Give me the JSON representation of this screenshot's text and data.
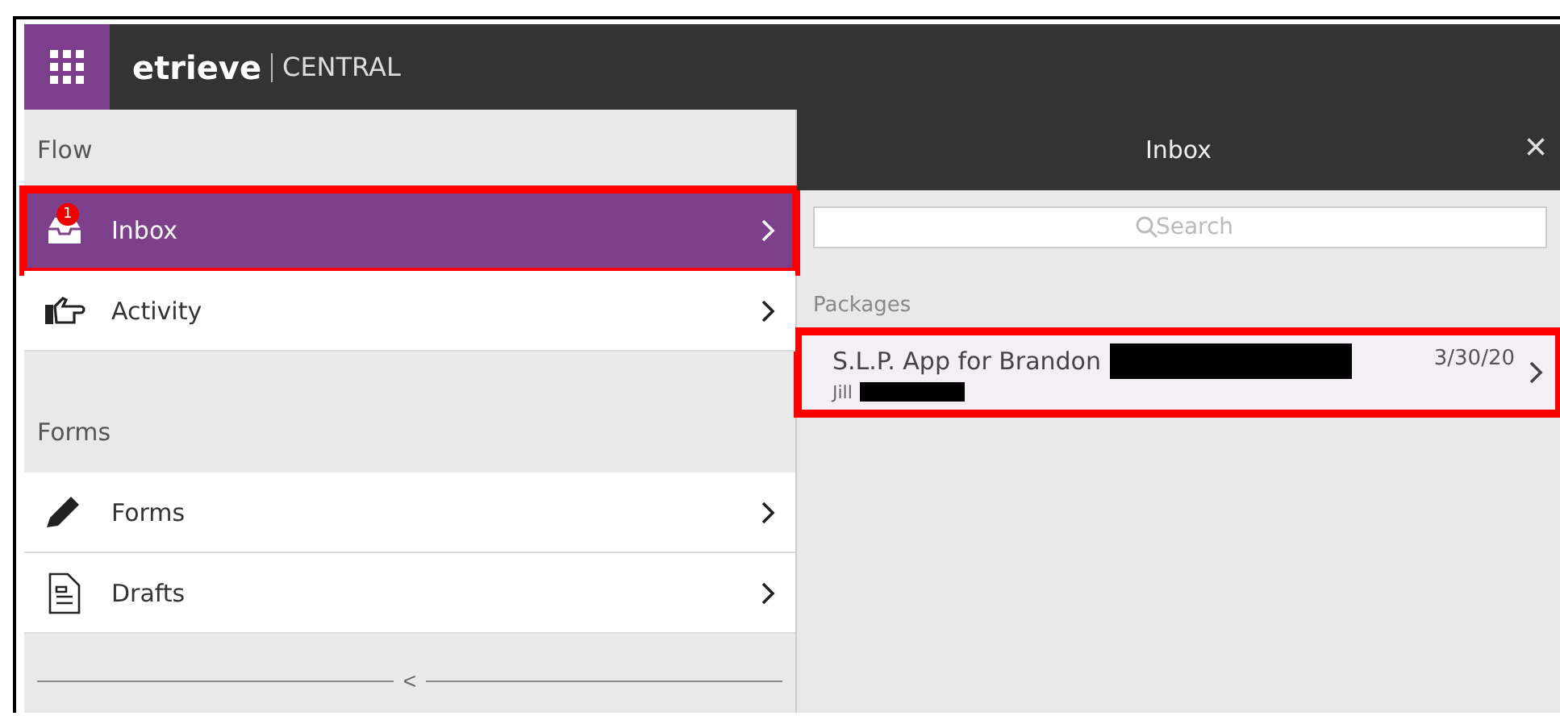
{
  "header": {
    "logo": "etrieve",
    "product": "CENTRAL"
  },
  "sidebar": {
    "sections": [
      {
        "title": "Flow",
        "items": [
          {
            "label": "Inbox",
            "kind": "inbox",
            "badge": "1",
            "selected": true,
            "highlighted": true
          },
          {
            "label": "Activity",
            "kind": "pointer",
            "selected": false,
            "highlighted": false
          }
        ]
      },
      {
        "title": "Forms",
        "items": [
          {
            "label": "Forms",
            "kind": "pencil",
            "selected": false,
            "highlighted": false
          },
          {
            "label": "Drafts",
            "kind": "document",
            "selected": false,
            "highlighted": false
          }
        ]
      }
    ],
    "collapse_glyph": "<"
  },
  "panel": {
    "title": "Inbox",
    "close": "×",
    "search": {
      "placeholder": "Search"
    },
    "group": "Packages",
    "items": [
      {
        "title": "S.L.P. App for Brandon",
        "sender": "Jill",
        "date": "3/30/20",
        "highlighted": true,
        "redacted": true
      }
    ]
  }
}
